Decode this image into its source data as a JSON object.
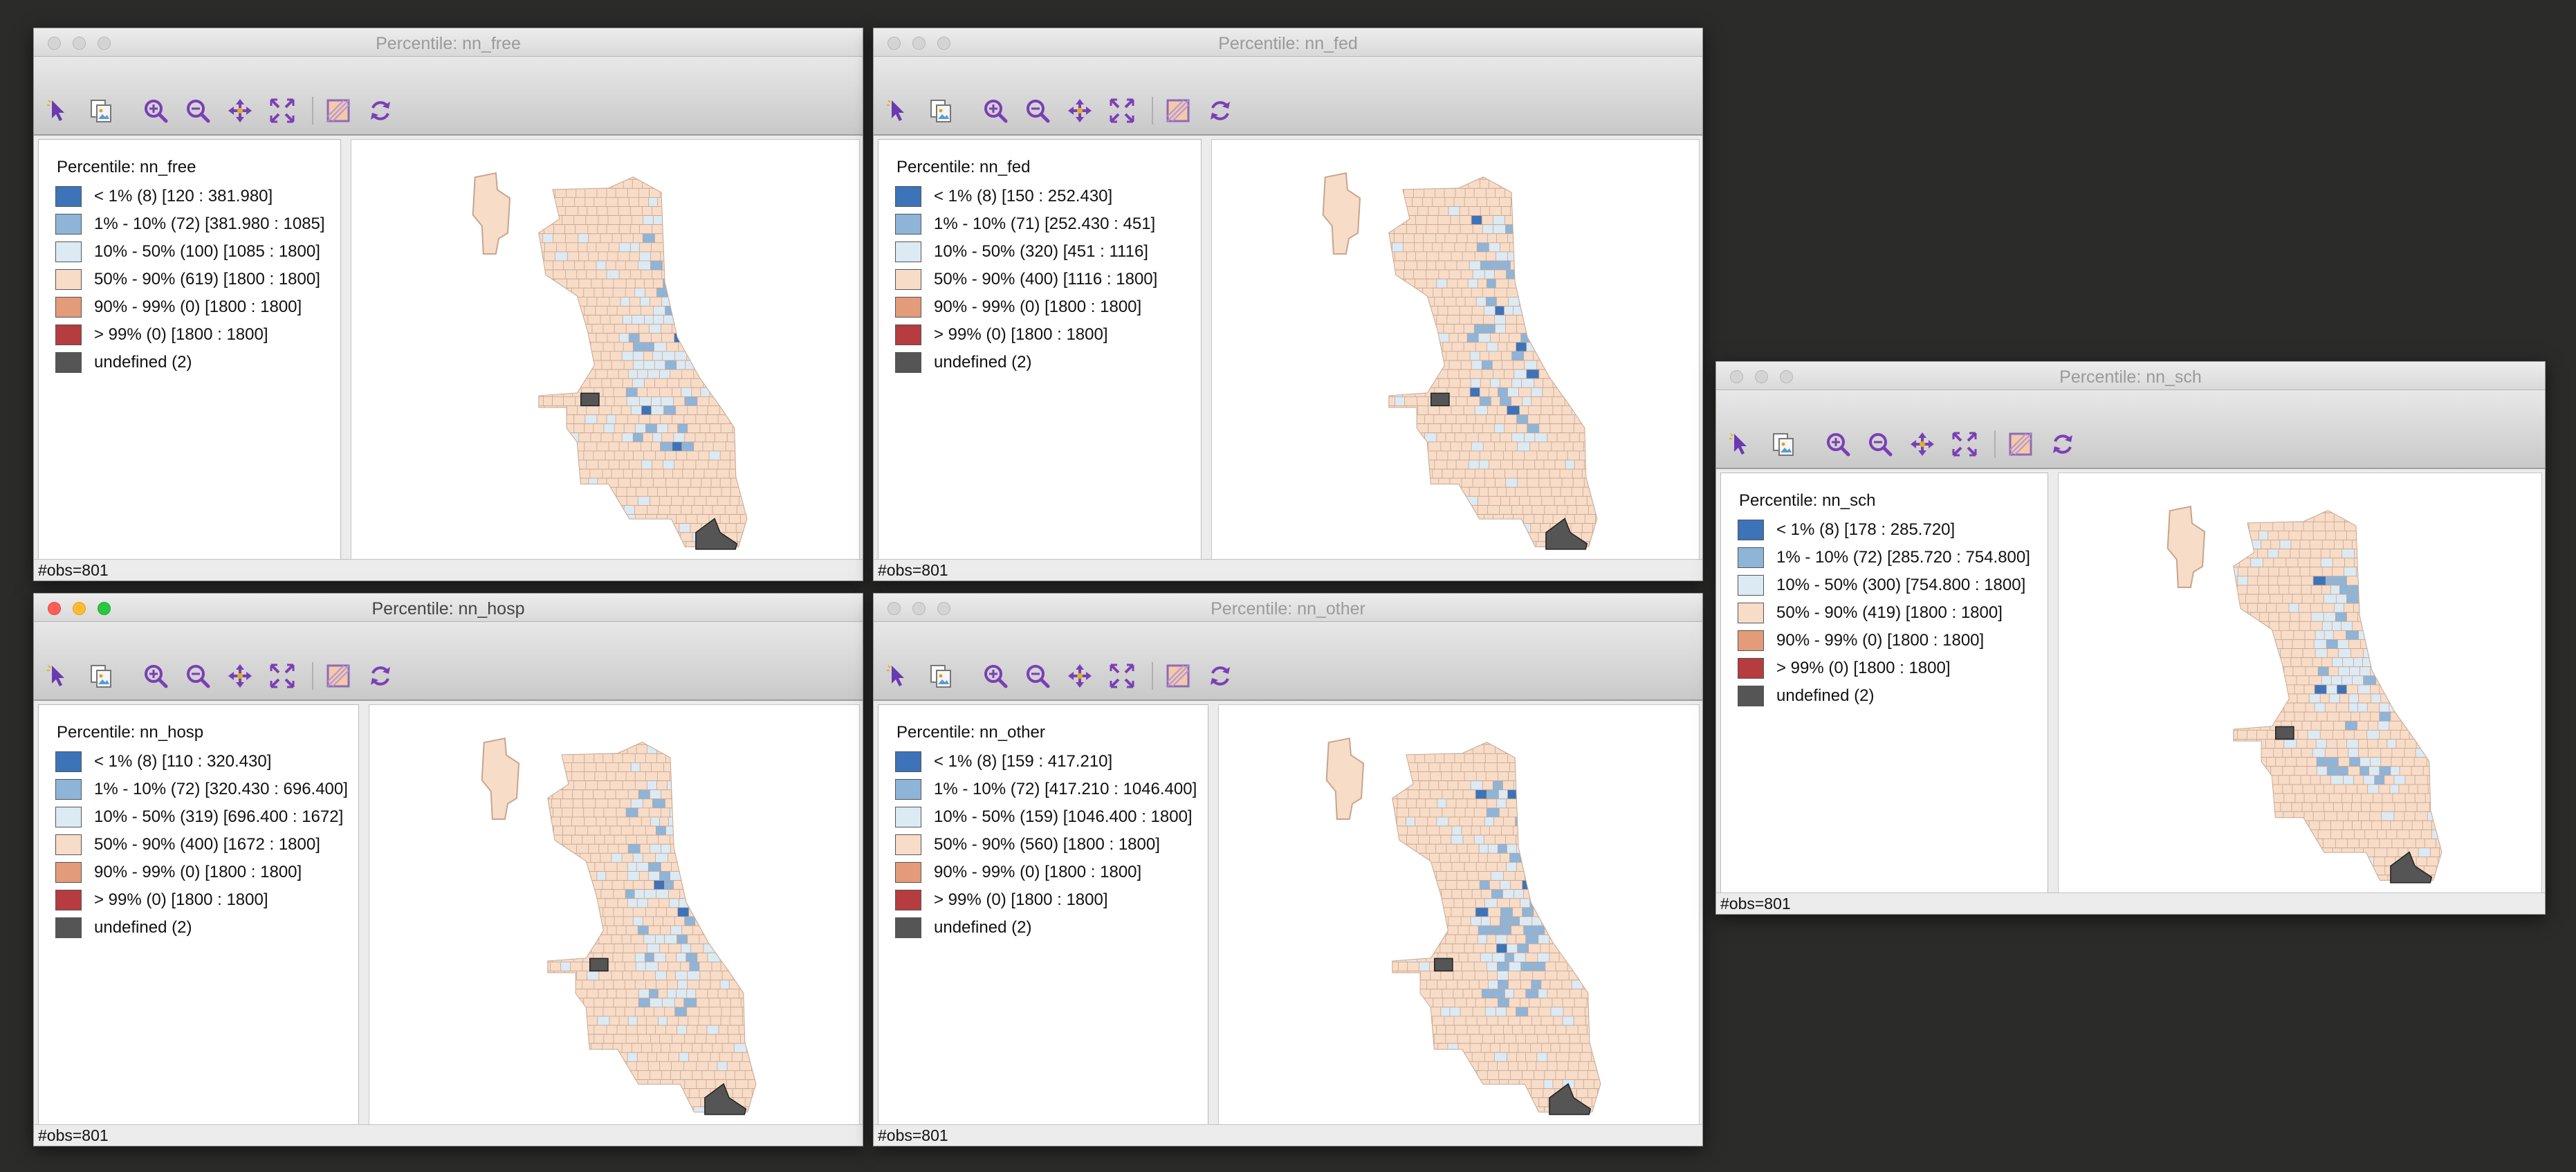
{
  "icons": [
    "select-arrow-icon",
    "copy-image-icon",
    "zoom-in-icon",
    "zoom-out-icon",
    "pan-icon",
    "full-extent-icon",
    "selection-shape-icon",
    "refresh-icon"
  ],
  "colors": {
    "p1": "#3d73b8",
    "p10": "#8eb4d8",
    "p50": "#dceaf4",
    "p90": "#f7dcc8",
    "p99": "#e39b7a",
    "pmax": "#b63c3f",
    "undefined": "#555555"
  },
  "windows": [
    {
      "id": "nn_free",
      "title": "Percentile: nn_free",
      "status": "#obs=801",
      "active": false,
      "legend": {
        "title": "Percentile: nn_free",
        "items": [
          {
            "label": "< 1% (8)  [120 : 381.980]",
            "color": "#3d73b8"
          },
          {
            "label": "1% - 10% (72)  [381.980 : 1085]",
            "color": "#8eb4d8"
          },
          {
            "label": "10% - 50% (100)  [1085 : 1800]",
            "color": "#dceaf4"
          },
          {
            "label": "50% - 90% (619)  [1800 : 1800]",
            "color": "#f7dcc8"
          },
          {
            "label": "90% - 99% (0)  [1800 : 1800]",
            "color": "#e39b7a"
          },
          {
            "label": "> 99% (0)  [1800 : 1800]",
            "color": "#b63c3f"
          },
          {
            "label": "undefined (2)",
            "color": "#555555"
          }
        ]
      }
    },
    {
      "id": "nn_fed",
      "title": "Percentile: nn_fed",
      "status": "#obs=801",
      "active": false,
      "legend": {
        "title": "Percentile: nn_fed",
        "items": [
          {
            "label": "< 1% (8)  [150 : 252.430]",
            "color": "#3d73b8"
          },
          {
            "label": "1% - 10% (71)  [252.430 : 451]",
            "color": "#8eb4d8"
          },
          {
            "label": "10% - 50% (320)  [451 : 1116]",
            "color": "#dceaf4"
          },
          {
            "label": "50% - 90% (400)  [1116 : 1800]",
            "color": "#f7dcc8"
          },
          {
            "label": "90% - 99% (0)  [1800 : 1800]",
            "color": "#e39b7a"
          },
          {
            "label": "> 99% (0)  [1800 : 1800]",
            "color": "#b63c3f"
          },
          {
            "label": "undefined (2)",
            "color": "#555555"
          }
        ]
      }
    },
    {
      "id": "nn_hosp",
      "title": "Percentile: nn_hosp",
      "status": "#obs=801",
      "active": true,
      "legend": {
        "title": "Percentile: nn_hosp",
        "items": [
          {
            "label": "< 1% (8)  [110 : 320.430]",
            "color": "#3d73b8"
          },
          {
            "label": "1% - 10% (72)  [320.430 : 696.400]",
            "color": "#8eb4d8"
          },
          {
            "label": "10% - 50% (319)  [696.400 : 1672]",
            "color": "#dceaf4"
          },
          {
            "label": "50% - 90% (400)  [1672 : 1800]",
            "color": "#f7dcc8"
          },
          {
            "label": "90% - 99% (0)  [1800 : 1800]",
            "color": "#e39b7a"
          },
          {
            "label": "> 99% (0)  [1800 : 1800]",
            "color": "#b63c3f"
          },
          {
            "label": "undefined (2)",
            "color": "#555555"
          }
        ]
      }
    },
    {
      "id": "nn_other",
      "title": "Percentile: nn_other",
      "status": "#obs=801",
      "active": false,
      "legend": {
        "title": "Percentile: nn_other",
        "items": [
          {
            "label": "< 1% (8)  [159 : 417.210]",
            "color": "#3d73b8"
          },
          {
            "label": "1% - 10% (72)  [417.210 : 1046.400]",
            "color": "#8eb4d8"
          },
          {
            "label": "10% - 50% (159)  [1046.400 : 1800]",
            "color": "#dceaf4"
          },
          {
            "label": "50% - 90% (560)  [1800 : 1800]",
            "color": "#f7dcc8"
          },
          {
            "label": "90% - 99% (0)  [1800 : 1800]",
            "color": "#e39b7a"
          },
          {
            "label": "> 99% (0)  [1800 : 1800]",
            "color": "#b63c3f"
          },
          {
            "label": "undefined (2)",
            "color": "#555555"
          }
        ]
      }
    },
    {
      "id": "nn_sch",
      "title": "Percentile: nn_sch",
      "status": "#obs=801",
      "active": false,
      "legend": {
        "title": "Percentile: nn_sch",
        "items": [
          {
            "label": "< 1% (8)  [178 : 285.720]",
            "color": "#3d73b8"
          },
          {
            "label": "1% - 10% (72)  [285.720 : 754.800]",
            "color": "#8eb4d8"
          },
          {
            "label": "10% - 50% (300)  [754.800 : 1800]",
            "color": "#dceaf4"
          },
          {
            "label": "50% - 90% (419)  [1800 : 1800]",
            "color": "#f7dcc8"
          },
          {
            "label": "90% - 99% (0)  [1800 : 1800]",
            "color": "#e39b7a"
          },
          {
            "label": "> 99% (0)  [1800 : 1800]",
            "color": "#b63c3f"
          },
          {
            "label": "undefined (2)",
            "color": "#555555"
          }
        ]
      }
    }
  ]
}
